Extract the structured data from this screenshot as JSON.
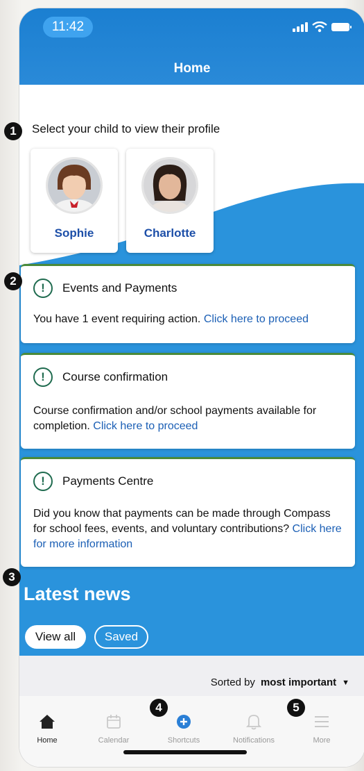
{
  "status_bar": {
    "time": "11:42"
  },
  "header": {
    "title": "Home"
  },
  "children_section": {
    "label": "Select your child to view their profile",
    "children": [
      {
        "name": "Sophie"
      },
      {
        "name": "Charlotte"
      }
    ]
  },
  "cards": [
    {
      "title": "Events and Payments",
      "body": "You have 1 event requiring action. ",
      "link": "Click here to proceed"
    },
    {
      "title": "Course confirmation",
      "body": "Course confirmation and/or school payments available for completion. ",
      "link": "Click here to proceed"
    },
    {
      "title": "Payments Centre",
      "body": "Did you know that payments can be made through Compass for school fees, events, and voluntary contributions? ",
      "link": "Click here for more information"
    }
  ],
  "news": {
    "title": "Latest news",
    "filters": [
      {
        "label": "View all"
      },
      {
        "label": "Saved"
      }
    ],
    "sort_prefix": "Sorted by",
    "sort_value": "most important"
  },
  "tabbar": {
    "items": [
      {
        "label": "Home",
        "icon": "home-icon"
      },
      {
        "label": "Calendar",
        "icon": "calendar-icon"
      },
      {
        "label": "Shortcuts",
        "icon": "plus-circle-icon"
      },
      {
        "label": "Notifications",
        "icon": "bell-icon"
      },
      {
        "label": "More",
        "icon": "menu-icon"
      }
    ]
  },
  "annotations": [
    "1",
    "2",
    "3",
    "4",
    "5"
  ],
  "colors": {
    "primary_blue": "#2a8ad8",
    "link_blue": "#1b5fb5",
    "alert_green": "#1f6b4f"
  }
}
